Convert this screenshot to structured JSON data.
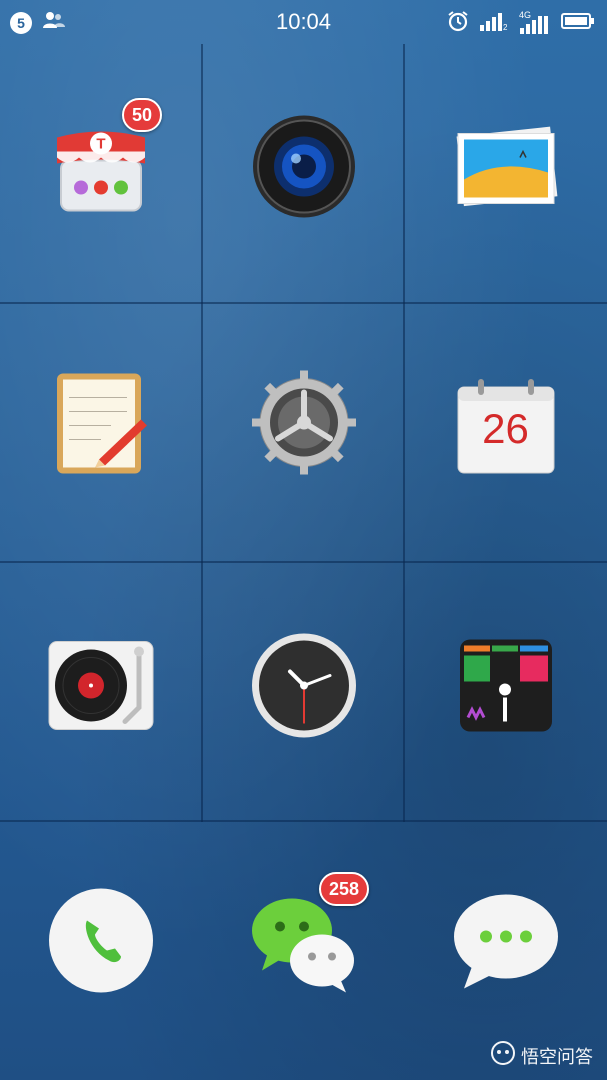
{
  "status_bar": {
    "notification_count": "5",
    "time": "10:04",
    "network_label": "4G",
    "icons": [
      "contacts-icon",
      "alarm-icon",
      "signal-icon",
      "signal-4g-icon",
      "battery-icon"
    ]
  },
  "apps": {
    "store": {
      "badge": "50",
      "icon": "store-icon"
    },
    "camera": {
      "icon": "camera-icon"
    },
    "gallery": {
      "icon": "gallery-icon"
    },
    "notes": {
      "icon": "notes-icon"
    },
    "settings": {
      "icon": "gear-icon"
    },
    "calendar": {
      "date": "26",
      "icon": "calendar-icon"
    },
    "music": {
      "icon": "record-player-icon"
    },
    "clock": {
      "icon": "clock-icon"
    },
    "tiles": {
      "icon": "tiles-icon"
    }
  },
  "dock": {
    "phone": {
      "icon": "phone-icon"
    },
    "wechat": {
      "badge": "258",
      "icon": "wechat-icon"
    },
    "messages": {
      "icon": "messages-icon"
    }
  },
  "watermark": {
    "text": "悟空问答"
  },
  "colors": {
    "background": "#2a649c",
    "badge": "#e53b3b",
    "calendar_red": "#d42a2a",
    "wechat_green": "#6ccf3c"
  }
}
